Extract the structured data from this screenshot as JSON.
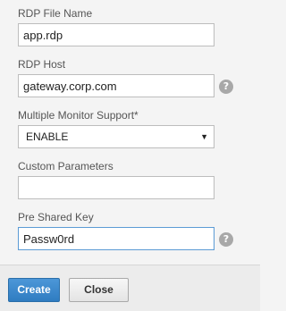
{
  "form": {
    "rdp_file_name": {
      "label": "RDP File Name",
      "value": "app.rdp"
    },
    "rdp_host": {
      "label": "RDP Host",
      "value": "gateway.corp.com"
    },
    "multiple_monitor_support": {
      "label": "Multiple Monitor Support*",
      "selected": "ENABLE",
      "arrow": "▼"
    },
    "custom_parameters": {
      "label": "Custom Parameters",
      "value": ""
    },
    "pre_shared_key": {
      "label": "Pre Shared Key",
      "value": "Passw0rd"
    },
    "help_glyph": "?"
  },
  "footer": {
    "create_label": "Create",
    "close_label": "Close"
  }
}
